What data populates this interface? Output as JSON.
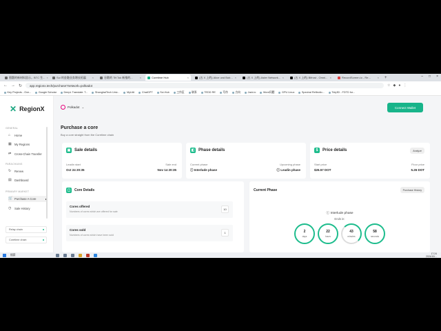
{
  "browser": {
    "tabs": [
      {
        "label": "图题的新材料显示，BTC 生..."
      },
      {
        "label": "Sui 的金融业务增长拓展"
      },
      {
        "label": "谷歌的 TiKTok 新推的..."
      },
      {
        "label": "Coretime Hub",
        "active": true
      },
      {
        "label": "(五 X 上的) Alice und Bob..."
      },
      {
        "label": "(五 X 上的) Aster Network..."
      },
      {
        "label": "(五 X 上的) Bifrost - Omni..."
      },
      {
        "label": "RecordScreen.io - Re..."
      }
    ],
    "url": "app.regionx.tech/purchase?network=polkadot",
    "bookmarks": [
      "Key Projects - Ove...",
      "Google Scholar",
      "DeepL Translate: T...",
      "ShanghaiTech Univ...",
      "MyUAI",
      "ChatGPT",
      "Sci-Hub",
      "工作区",
      "联系",
      "TEDD RE",
      "写作",
      "方向",
      "Jack.io",
      "Word问题",
      "GPU Linux",
      "Spectral Reflectio...",
      "Tidy3D - FDTD for..."
    ]
  },
  "sidebar": {
    "logo": "RegionX",
    "sections": {
      "general": "GENERAL",
      "parachains": "PARACHAINS",
      "primary_market": "PRIMARY MARKET"
    },
    "items": [
      {
        "label": "Home",
        "icon": "home-icon"
      },
      {
        "label": "My Regions",
        "icon": "grid-icon"
      },
      {
        "label": "Cross-Chain Transfer",
        "icon": "transfer-icon"
      },
      {
        "label": "Renew",
        "icon": "renew-icon"
      },
      {
        "label": "Dashboard",
        "icon": "dashboard-icon"
      },
      {
        "label": "Purchase A Core",
        "icon": "cart-icon",
        "active": true
      },
      {
        "label": "Sale History",
        "icon": "history-icon"
      }
    ],
    "chains": [
      "Relay chain",
      "Coretime chain"
    ]
  },
  "topbar": {
    "relay": "Polkadot",
    "connect": "Connect Wallet"
  },
  "page": {
    "title": "Purchase a core",
    "subtitle": "Buy a core straight from the Coretime chain"
  },
  "sale": {
    "title": "Sale details",
    "leadin_label": "Leadin start",
    "leadin_value": "Oct 24 20:35",
    "end_label": "Sale end",
    "end_value": "Nov 14 20:35"
  },
  "phase": {
    "title": "Phase details",
    "current_label": "Current phase",
    "current_value": "ⓘ Interlude phase",
    "upcoming_label": "Upcoming phase",
    "upcoming_value": "ⓘ Leadin phase"
  },
  "price": {
    "title": "Price details",
    "analyze": "Analyze",
    "start_label": "Start price",
    "start_value": "$26.57 DOT",
    "floor_label": "Floor price",
    "floor_value": "5.26 DOT"
  },
  "cores": {
    "title": "Core Details",
    "offered_title": "Cores offered",
    "offered_sub": "Numbers of cores which are offered for sale",
    "offered_value": "10",
    "sold_title": "Cores sold",
    "sold_sub": "Numbers of cores which have been sold",
    "sold_value": "1"
  },
  "current_phase": {
    "title": "Current Phase",
    "history": "Purchase History",
    "phase": "ⓘ Interlude phase",
    "ends": "Ends in:",
    "countdown": [
      {
        "value": "2",
        "unit": "days",
        "fraction": 1.0
      },
      {
        "value": "22",
        "unit": "hours",
        "fraction": 1.0
      },
      {
        "value": "43",
        "unit": "minutes",
        "fraction": 0.72
      },
      {
        "value": "58",
        "unit": "seconds",
        "fraction": 1.0
      }
    ]
  },
  "taskbar": {
    "search": "搜索",
    "time": "17:24",
    "date": "2024/10/..."
  },
  "colors": {
    "accent": "#18b48a",
    "polkadot": "#e6007a"
  }
}
